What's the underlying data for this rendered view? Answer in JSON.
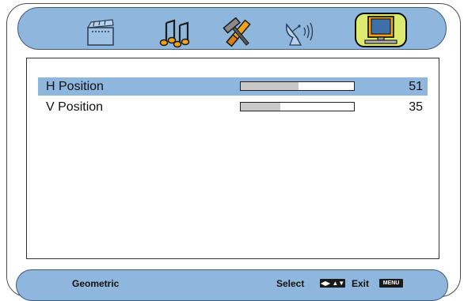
{
  "tabs": [
    {
      "icon": "clapperboard-icon",
      "selected": false
    },
    {
      "icon": "music-notes-icon",
      "selected": false
    },
    {
      "icon": "tools-icon",
      "selected": false
    },
    {
      "icon": "satellite-dish-icon",
      "selected": false
    },
    {
      "icon": "monitor-icon",
      "selected": true
    }
  ],
  "menu": {
    "items": [
      {
        "label": "H Position",
        "value": "51",
        "level": 51,
        "selected": true
      },
      {
        "label": "V Position",
        "value": "35",
        "level": 35,
        "selected": false
      }
    ]
  },
  "footer": {
    "title": "Geometric",
    "select_label": "Select",
    "exit_label": "Exit",
    "select_key_icon": "left-right-up-down-arrows-icon",
    "exit_key": "MENU"
  },
  "colors": {
    "bar_blue": "#8fb6dc",
    "selected_tab": "#dceb70",
    "highlight_row": "#8fb6dc"
  }
}
